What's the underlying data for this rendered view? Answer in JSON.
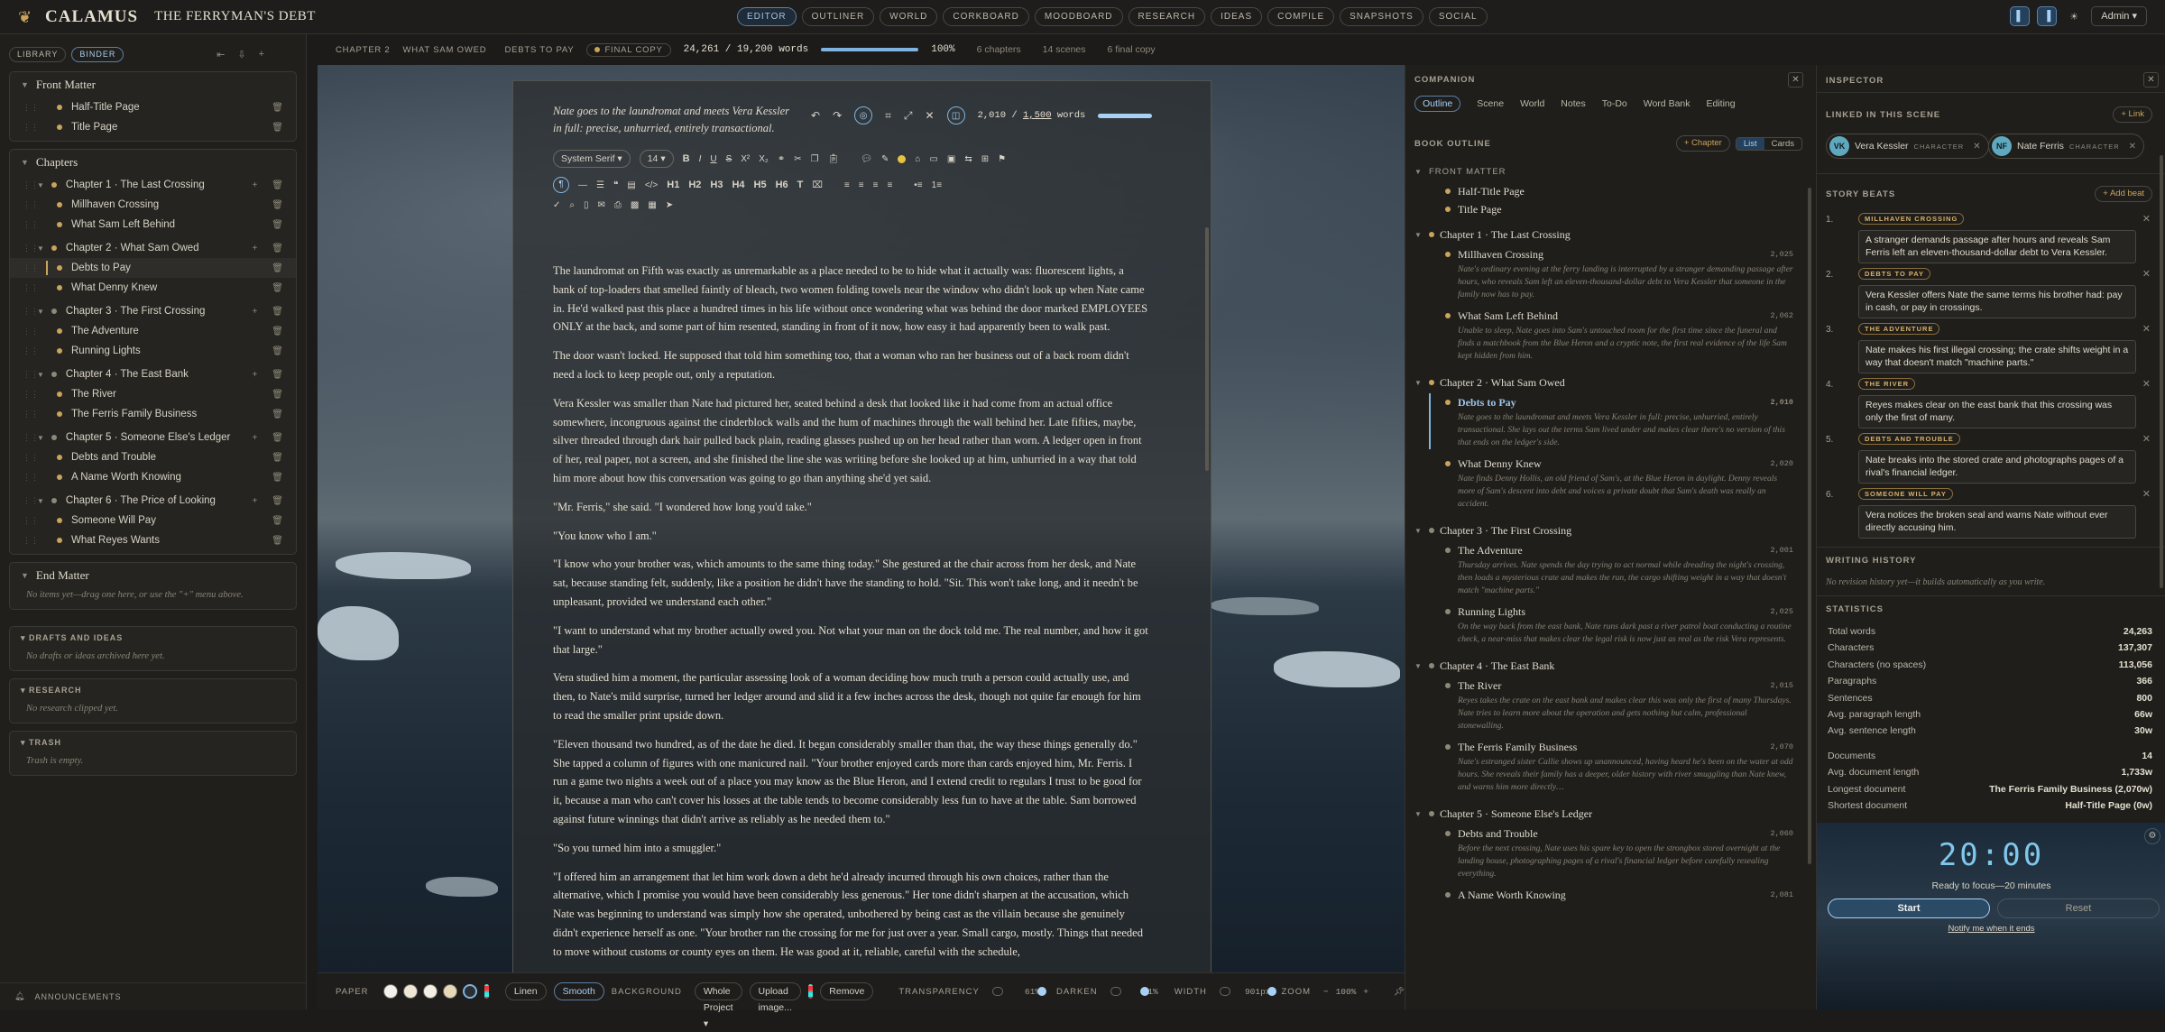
{
  "app": {
    "name": "CALAMUS",
    "project": "THE FERRYMAN'S DEBT",
    "admin": "Admin"
  },
  "nav_tabs": [
    {
      "label": "EDITOR",
      "active": true
    },
    {
      "label": "OUTLINER"
    },
    {
      "label": "WORLD"
    },
    {
      "label": "CORKBOARD"
    },
    {
      "label": "MOODBOARD"
    },
    {
      "label": "RESEARCH"
    },
    {
      "label": "IDEAS"
    },
    {
      "label": "COMPILE"
    },
    {
      "label": "SNAPSHOTS"
    },
    {
      "label": "SOCIAL"
    }
  ],
  "sidebar": {
    "tabs": [
      "LIBRARY",
      "BINDER"
    ],
    "front_matter": {
      "title": "Front Matter",
      "items": [
        "Half-Title Page",
        "Title Page"
      ]
    },
    "chapters": {
      "title": "Chapters",
      "list": [
        {
          "title": "Chapter 1 · The Last Crossing",
          "scenes": [
            "Millhaven Crossing",
            "What Sam Left Behind"
          ]
        },
        {
          "title": "Chapter 2 · What Sam Owed",
          "scenes": [
            "Debts to Pay",
            "What Denny Knew"
          ]
        },
        {
          "title": "Chapter 3 · The First Crossing",
          "scenes": [
            "The Adventure",
            "Running Lights"
          ]
        },
        {
          "title": "Chapter 4 · The East Bank",
          "scenes": [
            "The River",
            "The Ferris Family Business"
          ]
        },
        {
          "title": "Chapter 5 · Someone Else's Ledger",
          "scenes": [
            "Debts and Trouble",
            "A Name Worth Knowing"
          ]
        },
        {
          "title": "Chapter 6 · The Price of Looking",
          "scenes": [
            "Someone Will Pay",
            "What Reyes Wants"
          ]
        }
      ]
    },
    "end_matter": {
      "title": "End Matter",
      "empty": "No items yet—drag one here, or use the \"+\" menu above."
    },
    "drafts": {
      "title": "DRAFTS AND IDEAS",
      "empty": "No drafts or ideas archived here yet."
    },
    "research": {
      "title": "RESEARCH",
      "empty": "No research clipped yet."
    },
    "trash": {
      "title": "TRASH",
      "empty": "Trash is empty."
    },
    "announcements": "ANNOUNCEMENTS"
  },
  "status": {
    "crumb1": "CHAPTER 2",
    "crumb2": "WHAT SAM OWED",
    "crumb3": "DEBTS TO PAY",
    "badge": "FINAL COPY",
    "words": "24,261 / 19,200 words",
    "progress": 1.0,
    "percent": "100%",
    "chapters": "6 chapters",
    "scenes": "14 scenes",
    "final": "6 final copy"
  },
  "editor": {
    "synopsis": "Nate goes to the laundromat and meets Vera Kessler in full: precise, unhurried, entirely transactional.",
    "scene_words": "2,010",
    "scene_target": "1,500",
    "scene_words_suffix": "words",
    "font": "System Serif",
    "size": "14",
    "paragraphs": [
      "The laundromat on Fifth was exactly as unremarkable as a place needed to be to hide what it actually was: fluorescent lights, a bank of top-loaders that smelled faintly of bleach, two women folding towels near the window who didn't look up when Nate came in. He'd walked past this place a hundred times in his life without once wondering what was behind the door marked EMPLOYEES ONLY at the back, and some part of him resented, standing in front of it now, how easy it had apparently been to walk past.",
      "The door wasn't locked. He supposed that told him something too, that a woman who ran her business out of a back room didn't need a lock to keep people out, only a reputation.",
      "Vera Kessler was smaller than Nate had pictured her, seated behind a desk that looked like it had come from an actual office somewhere, incongruous against the cinderblock walls and the hum of machines through the wall behind her. Late fifties, maybe, silver threaded through dark hair pulled back plain, reading glasses pushed up on her head rather than worn. A ledger open in front of her, real paper, not a screen, and she finished the line she was writing before she looked up at him, unhurried in a way that told him more about how this conversation was going to go than anything she'd yet said.",
      "\"Mr. Ferris,\" she said. \"I wondered how long you'd take.\"",
      "\"You know who I am.\"",
      "\"I know who your brother was, which amounts to the same thing today.\" She gestured at the chair across from her desk, and Nate sat, because standing felt, suddenly, like a position he didn't have the standing to hold. \"Sit. This won't take long, and it needn't be unpleasant, provided we understand each other.\"",
      "\"I want to understand what my brother actually owed you. Not what your man on the dock told me. The real number, and how it got that large.\"",
      "Vera studied him a moment, the particular assessing look of a woman deciding how much truth a person could actually use, and then, to Nate's mild surprise, turned her ledger around and slid it a few inches across the desk, though not quite far enough for him to read the smaller print upside down.",
      "\"Eleven thousand two hundred, as of the date he died. It began considerably smaller than that, the way these things generally do.\" She tapped a column of figures with one manicured nail. \"Your brother enjoyed cards more than cards enjoyed him, Mr. Ferris. I run a game two nights a week out of a place you may know as the Blue Heron, and I extend credit to regulars I trust to be good for it, because a man who can't cover his losses at the table tends to become considerably less fun to have at the table. Sam borrowed against future winnings that didn't arrive as reliably as he needed them to.\"",
      "\"So you turned him into a smuggler.\"",
      "\"I offered him an arrangement that let him work down a debt he'd already incurred through his own choices, rather than the alternative, which I promise you would have been considerably less generous.\" Her tone didn't sharpen at the accusation, which Nate was beginning to understand was simply how she operated, unbothered by being cast as the villain because she genuinely didn't experience herself as one. \"Your brother ran the crossing for me for just over a year. Small cargo, mostly. Things that needed to move without customs or county eyes on them. He was good at it, reliable, careful with the schedule,"
    ]
  },
  "bottom": {
    "paper": "PAPER",
    "swatches": [
      "#f4f1ea",
      "#efe7d6",
      "#f3efe6",
      "#e7d9b8",
      "#2b2f33"
    ],
    "linen": "Linen",
    "smooth": "Smooth",
    "background": "BACKGROUND",
    "scope": "Whole Project",
    "upload": "Upload image...",
    "remove": "Remove",
    "transparency": "TRANSPARENCY",
    "transparency_val": "61%",
    "transparency_level": 0.61,
    "darken": "DARKEN",
    "darken_val": "41%",
    "darken_level": 0.41,
    "width": "WIDTH",
    "width_val": "901px",
    "width_level": 0.65,
    "zoom": "ZOOM",
    "zoom_val": "100%"
  },
  "companion": {
    "title": "COMPANION",
    "tabs": [
      "Outline",
      "Scene",
      "World",
      "Notes",
      "To-Do",
      "Word Bank",
      "Editing"
    ],
    "book_outline": "BOOK OUTLINE",
    "add_chapter": "+ Chapter",
    "view": [
      "List",
      "Cards"
    ],
    "front_matter": "FRONT MATTER",
    "front_items": [
      "Half-Title Page",
      "Title Page"
    ],
    "chapters": [
      {
        "title": "Chapter 1 · The Last Crossing",
        "scenes": [
          {
            "title": "Millhaven Crossing",
            "words": "2,025",
            "synopsis": "Nate's ordinary evening at the ferry landing is interrupted by a stranger demanding passage after hours, who reveals Sam left an eleven-thousand-dollar debt to Vera Kessler that someone in the family now has to pay."
          },
          {
            "title": "What Sam Left Behind",
            "words": "2,062",
            "synopsis": "Unable to sleep, Nate goes into Sam's untouched room for the first time since the funeral and finds a matchbook from the Blue Heron and a cryptic note, the first real evidence of the life Sam kept hidden from him."
          }
        ]
      },
      {
        "title": "Chapter 2 · What Sam Owed",
        "scenes": [
          {
            "title": "Debts to Pay",
            "words": "2,010",
            "synopsis": "Nate goes to the laundromat and meets Vera Kessler in full: precise, unhurried, entirely transactional. She lays out the terms Sam lived under and makes clear there's no version of this that ends on the ledger's side.",
            "active": true
          },
          {
            "title": "What Denny Knew",
            "words": "2,020",
            "synopsis": "Nate finds Denny Hollis, an old friend of Sam's, at the Blue Heron in daylight. Denny reveals more of Sam's descent into debt and voices a private doubt that Sam's death was really an accident."
          }
        ]
      },
      {
        "title": "Chapter 3 · The First Crossing",
        "scenes": [
          {
            "title": "The Adventure",
            "words": "2,001",
            "synopsis": "Thursday arrives. Nate spends the day trying to act normal while dreading the night's crossing, then loads a mysterious crate and makes the run, the cargo shifting weight in a way that doesn't match \"machine parts.\""
          },
          {
            "title": "Running Lights",
            "words": "2,025",
            "synopsis": "On the way back from the east bank, Nate runs dark past a river patrol boat conducting a routine check, a near-miss that makes clear the legal risk is now just as real as the risk Vera represents."
          }
        ]
      },
      {
        "title": "Chapter 4 · The East Bank",
        "scenes": [
          {
            "title": "The River",
            "words": "2,015",
            "synopsis": "Reyes takes the crate on the east bank and makes clear this was only the first of many Thursdays. Nate tries to learn more about the operation and gets nothing but calm, professional stonewalling."
          },
          {
            "title": "The Ferris Family Business",
            "words": "2,070",
            "synopsis": "Nate's estranged sister Callie shows up unannounced, having heard he's been on the water at odd hours. She reveals their family has a deeper, older history with river smuggling than Nate knew, and warns him more directly…"
          }
        ]
      },
      {
        "title": "Chapter 5 · Someone Else's Ledger",
        "scenes": [
          {
            "title": "Debts and Trouble",
            "words": "2,060",
            "synopsis": "Before the next crossing, Nate uses his spare key to open the strongbox stored overnight at the landing house, photographing pages of a rival's financial ledger before carefully resealing everything."
          },
          {
            "title": "A Name Worth Knowing",
            "words": "2,081",
            "synopsis": ""
          }
        ]
      }
    ]
  },
  "inspector": {
    "title": "INSPECTOR",
    "linked": "LINKED IN THIS SCENE",
    "add_link": "+ Link",
    "chars": [
      {
        "initials": "VK",
        "name": "Vera Kessler",
        "kind": "CHARACTER"
      },
      {
        "initials": "NF",
        "name": "Nate Ferris",
        "kind": "CHARACTER"
      }
    ],
    "beats_title": "STORY BEATS",
    "add_beat": "+ Add beat",
    "beats": [
      {
        "n": "1.",
        "tag": "MILLHAVEN CROSSING",
        "text": "A stranger demands passage after hours and reveals Sam Ferris left an eleven-thousand-dollar debt to Vera Kessler."
      },
      {
        "n": "2.",
        "tag": "DEBTS TO PAY",
        "text": "Vera Kessler offers Nate the same terms his brother had: pay in cash, or pay in crossings."
      },
      {
        "n": "3.",
        "tag": "THE ADVENTURE",
        "text": "Nate makes his first illegal crossing; the crate shifts weight in a way that doesn't match \"machine parts.\""
      },
      {
        "n": "4.",
        "tag": "THE RIVER",
        "text": "Reyes makes clear on the east bank that this crossing was only the first of many."
      },
      {
        "n": "5.",
        "tag": "DEBTS AND TROUBLE",
        "text": "Nate breaks into the stored crate and photographs pages of a rival's financial ledger."
      },
      {
        "n": "6.",
        "tag": "SOMEONE WILL PAY",
        "text": "Vera notices the broken seal and warns Nate without ever directly accusing him."
      }
    ],
    "writing_history": "WRITING HISTORY",
    "history_empty": "No revision history yet—it builds automatically as you write.",
    "statistics": "STATISTICS",
    "stats": [
      {
        "k": "Total words",
        "v": "24,263"
      },
      {
        "k": "Characters",
        "v": "137,307"
      },
      {
        "k": "Characters (no spaces)",
        "v": "113,056"
      },
      {
        "k": "Paragraphs",
        "v": "366"
      },
      {
        "k": "Sentences",
        "v": "800"
      },
      {
        "k": "Avg. paragraph length",
        "v": "66w"
      },
      {
        "k": "Avg. sentence length",
        "v": "30w"
      }
    ],
    "stats2": [
      {
        "k": "Documents",
        "v": "14"
      },
      {
        "k": "Avg. document length",
        "v": "1,733w"
      },
      {
        "k": "Longest document",
        "v": "The Ferris Family Business (2,070w)"
      },
      {
        "k": "Shortest document",
        "v": "Half-Title Page (0w)"
      }
    ],
    "timer": {
      "time": "20:00",
      "ready": "Ready to focus—20 minutes",
      "start": "Start",
      "reset": "Reset",
      "notify": "Notify me when it ends"
    }
  }
}
